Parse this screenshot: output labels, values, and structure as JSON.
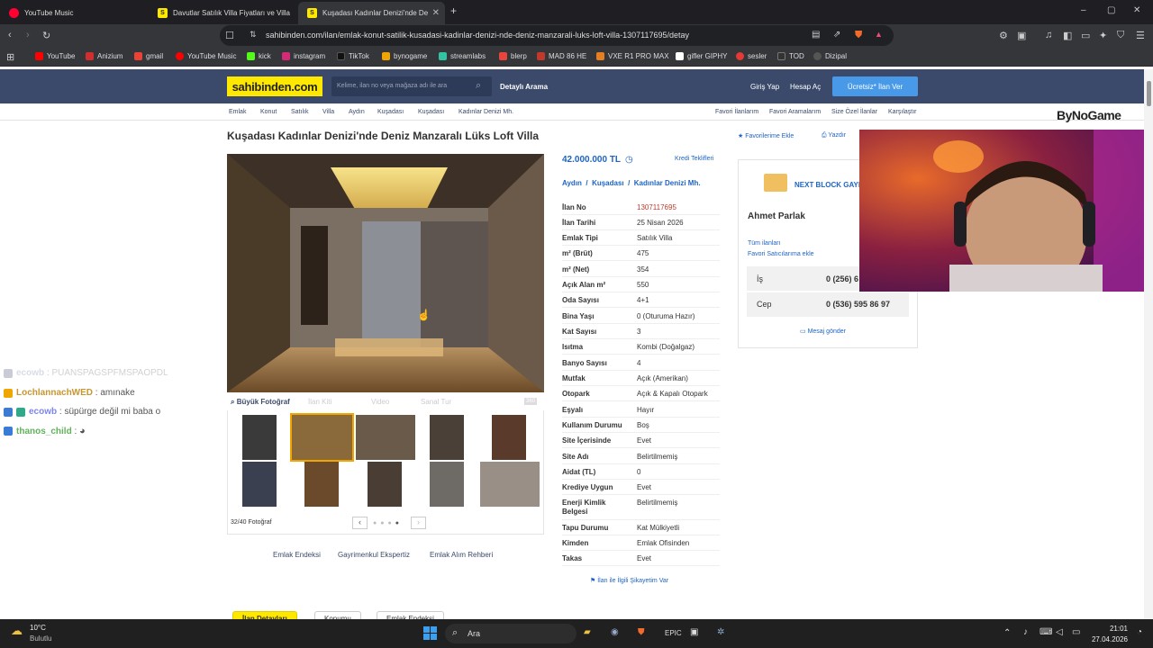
{
  "tabs": [
    {
      "label": "YouTube Music",
      "icon": "youtube-music-icon"
    },
    {
      "label": "Davutlar Satılık Villa Fiyatları ve Villa",
      "icon": "sahibinden-icon"
    },
    {
      "label": "Kuşadası Kadınlar Denizi'nde De",
      "icon": "sahibinden-icon"
    }
  ],
  "window": {
    "minimize": "–",
    "maximize": "▢",
    "close": "✕",
    "new_tab": "+"
  },
  "address": {
    "url": "sahibinden.com/ilan/emlak-konut-satilik-kusadasi-kadinlar-denizi-nde-deniz-manzarali-luks-loft-villa-1307117695/detay"
  },
  "bookmarks": [
    {
      "label": "YouTube",
      "color": "#ff0000"
    },
    {
      "label": "Anizium",
      "color": "#d12f2f"
    },
    {
      "label": "gmail",
      "color": "#ea4335"
    },
    {
      "label": "YouTube Music",
      "color": "#ff0000"
    },
    {
      "label": "kick",
      "color": "#53fc18"
    },
    {
      "label": "instagram",
      "color": "#d62976"
    },
    {
      "label": "TikTok",
      "color": "#111111"
    },
    {
      "label": "bynogame",
      "color": "#f0a500"
    },
    {
      "label": "streamlabs",
      "color": "#31c3a2"
    },
    {
      "label": "blerp",
      "color": "#e8453c"
    },
    {
      "label": "MAD 86 HE",
      "color": "#c0392b"
    },
    {
      "label": "VXE R1 PRO MAX",
      "color": "#e67e22"
    },
    {
      "label": "gifler GIPHY",
      "color": "#ffffff"
    },
    {
      "label": "sesler",
      "color": "#e53935"
    },
    {
      "label": "TOD",
      "color": "#333333"
    },
    {
      "label": "Dizipal",
      "color": "#555555"
    }
  ],
  "site": {
    "logo": "sahibinden.com",
    "search_placeholder": "Kelime, ilan no veya mağaza adı ile ara",
    "detailed_search": "Detaylı Arama",
    "login": "Giriş Yap",
    "register": "Hesap Aç",
    "cta": "Ücretsiz* İlan Ver"
  },
  "breadcrumb": [
    "Emlak",
    "Konut",
    "Satılık",
    "Villa",
    "Aydın",
    "Kuşadası",
    "Kuşadası",
    "Kadınlar Denizi Mh."
  ],
  "top_links": [
    "Favori İlanlarım",
    "Favori Aramalarım",
    "Size Özel İlanlar",
    "Karşılaştır"
  ],
  "overlay_brand": "ByNoGame",
  "listing": {
    "title": "Kuşadası Kadınlar Denizi'nde Deniz Manzaralı Lüks Loft Villa",
    "add_favorite": "Favorilerime Ekle",
    "print": "Yazdır",
    "price": "42.000.000 TL",
    "credit_offers": "Kredi Teklifleri",
    "location": [
      "Aydın",
      "Kuşadası",
      "Kadınlar Denizi Mh."
    ],
    "details": [
      {
        "label": "İlan No",
        "value": "1307117695"
      },
      {
        "label": "İlan Tarihi",
        "value": "25 Nisan 2026"
      },
      {
        "label": "Emlak Tipi",
        "value": "Satılık Villa"
      },
      {
        "label": "m² (Brüt)",
        "value": "475"
      },
      {
        "label": "m² (Net)",
        "value": "354"
      },
      {
        "label": "Açık Alan m²",
        "value": "550"
      },
      {
        "label": "Oda Sayısı",
        "value": "4+1"
      },
      {
        "label": "Bina Yaşı",
        "value": "0 (Oturuma Hazır)"
      },
      {
        "label": "Kat Sayısı",
        "value": "3"
      },
      {
        "label": "Isıtma",
        "value": "Kombi (Doğalgaz)"
      },
      {
        "label": "Banyo Sayısı",
        "value": "4"
      },
      {
        "label": "Mutfak",
        "value": "Açık (Amerikan)"
      },
      {
        "label": "Otopark",
        "value": "Açık & Kapalı Otopark"
      },
      {
        "label": "Eşyalı",
        "value": "Hayır"
      },
      {
        "label": "Kullanım Durumu",
        "value": "Boş"
      },
      {
        "label": "Site İçerisinde",
        "value": "Evet"
      },
      {
        "label": "Site Adı",
        "value": "Belirtilmemiş"
      },
      {
        "label": "Aidat (TL)",
        "value": "0"
      },
      {
        "label": "Krediye Uygun",
        "value": "Evet"
      },
      {
        "label": "Enerji Kimlik Belgesi",
        "value": "Belirtilmemiş"
      },
      {
        "label": "Tapu Durumu",
        "value": "Kat Mülkiyetli"
      },
      {
        "label": "Kimden",
        "value": "Emlak Ofisinden"
      },
      {
        "label": "Takas",
        "value": "Evet"
      }
    ],
    "complaint": "İlan ile İlgili Şikayetim Var",
    "photo_tools": [
      "Büyük Fotoğraf",
      "İlan Kiti",
      "Video",
      "Sanal Tur",
      "360"
    ],
    "photo_count": "32/40 Fotoğraf",
    "bottom_links": [
      "Emlak Endeksi",
      "Gayrimenkul Ekspertiz",
      "Emlak Alım Rehberi"
    ],
    "bottom_tabs": [
      "İlan Detayları",
      "Konumu",
      "Emlak Endeksi"
    ]
  },
  "seller": {
    "agency": "NEXT BLOCK GAYR",
    "name": "Ahmet Parlak",
    "all_listings": "Tüm ilanları",
    "add_favorite_seller": "Favori Satıcılarıma ekle",
    "work_label": "İş",
    "work_phone": "0 (256) 6",
    "mobile_label": "Cep",
    "mobile_phone": "0 (536) 595 86 97",
    "message": "Mesaj gönder"
  },
  "chat": [
    {
      "user": "ecowb",
      "message": "PUANSPAGSPFMSPAOPDL",
      "user_color": "#aab0c8",
      "faded": true
    },
    {
      "user": "LochlannachWED",
      "message": "amınake",
      "user_color": "#f0c34e",
      "faded": false
    },
    {
      "user": "ecowb",
      "message": "süpürge değil mi baba o",
      "user_color": "#9aa3ff",
      "faded": false
    },
    {
      "user": "thanos_child",
      "message": "",
      "user_color": "#7bd36b",
      "faded": false
    }
  ],
  "taskbar": {
    "weather_temp": "10°C",
    "weather_desc": "Bulutlu",
    "search": "Ara",
    "time": "21:01",
    "date": "27.04.2026"
  }
}
